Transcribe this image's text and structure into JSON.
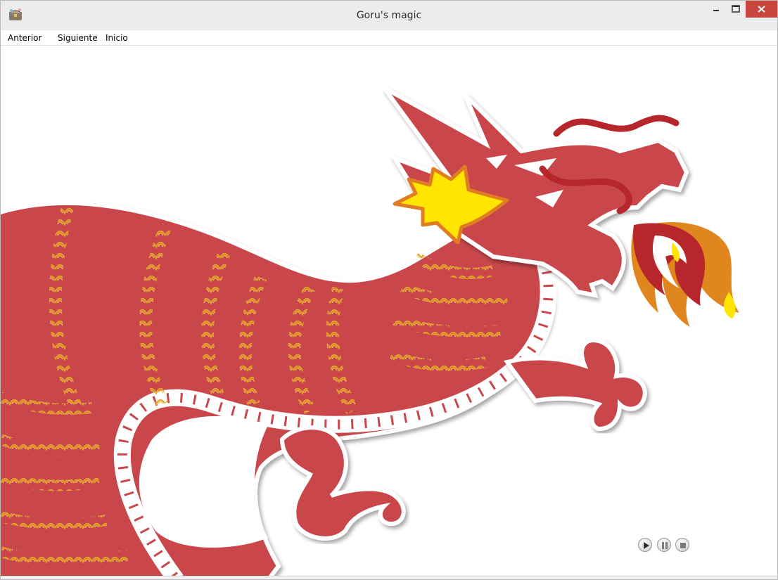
{
  "window": {
    "title": "Goru's magic",
    "icon": "app-chest-icon",
    "controls": {
      "minimize_icon": "minimize-icon",
      "maximize_icon": "maximize-icon",
      "close_icon": "close-icon"
    }
  },
  "menu": {
    "items": [
      {
        "label": "Anterior"
      },
      {
        "label": "Siguiente"
      },
      {
        "label": "Inicio"
      }
    ]
  },
  "player": {
    "buttons": [
      {
        "icon": "play-icon"
      },
      {
        "icon": "pause-icon"
      },
      {
        "icon": "stop-icon"
      }
    ]
  },
  "colors": {
    "dragon_red": "#c9464b",
    "dragon_dark_red": "#b7262b",
    "pattern_gold": "#e3a32a",
    "crest_yellow": "#ffe500",
    "crest_orange": "#e07d22",
    "flame_orange": "#e0861f",
    "close_button": "#c7463e"
  }
}
